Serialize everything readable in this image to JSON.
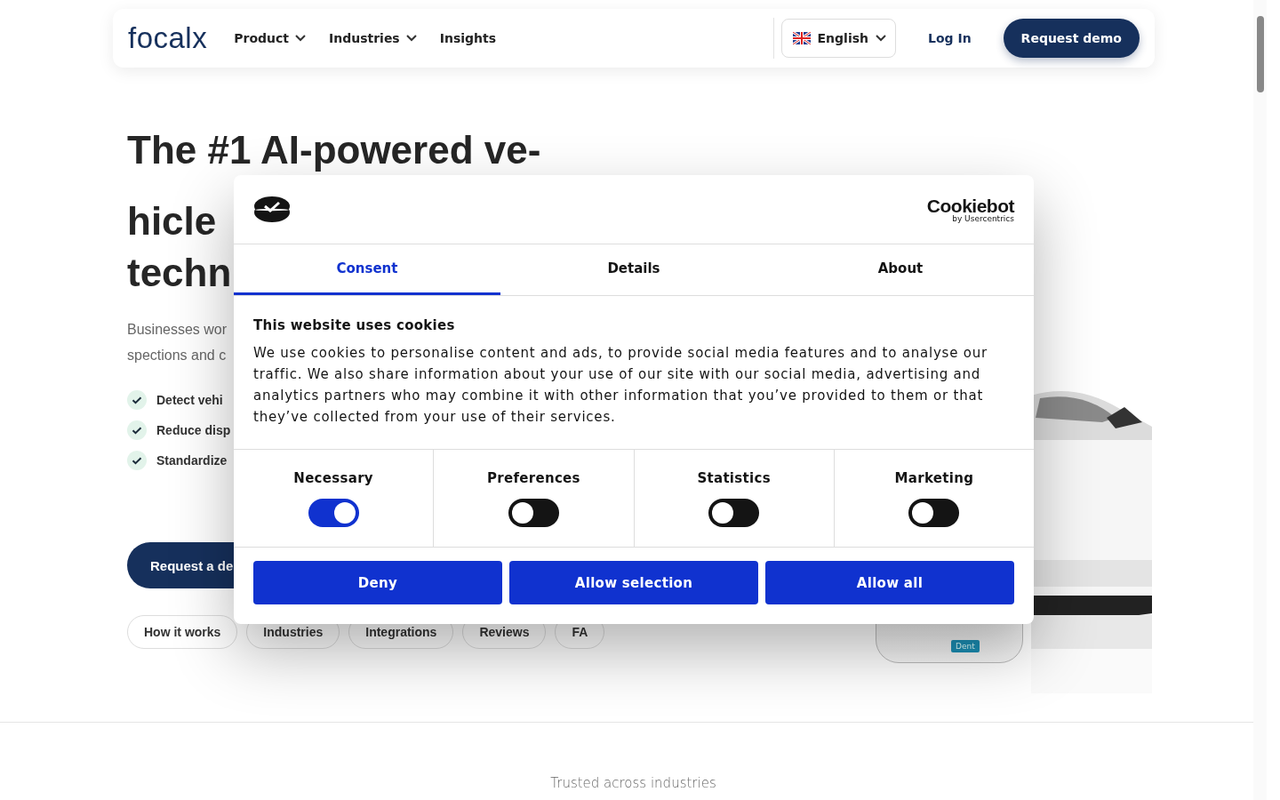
{
  "header": {
    "logo": "focalx",
    "nav": [
      {
        "label": "Product",
        "dropdown": true
      },
      {
        "label": "Industries",
        "dropdown": true
      },
      {
        "label": "Insights",
        "dropdown": false
      }
    ],
    "language": "English",
    "login": "Log In",
    "cta": "Request demo"
  },
  "hero": {
    "heading": [
      "The #1 AI-powered ve-",
      "hicle",
      "techn"
    ],
    "description": [
      "Businesses wor",
      "spections and c"
    ],
    "features": [
      "Detect vehi",
      "Reduce disp",
      "Standardize"
    ],
    "cta": "Request a de",
    "pills": [
      {
        "label": "How it works"
      },
      {
        "label": "Industries"
      },
      {
        "label": "Integrations"
      },
      {
        "label": "Reviews"
      },
      {
        "label": "FA"
      }
    ]
  },
  "showcase": {
    "kind": "picture",
    "tag": "Dent"
  },
  "trusted": "Trusted across industries",
  "cookie_dialog": {
    "brand": "Cookiebot",
    "brand_sub": "by Usercentrics",
    "tabs": [
      {
        "label": "Consent",
        "selected": true
      },
      {
        "label": "Details",
        "selected": false
      },
      {
        "label": "About",
        "selected": false
      }
    ],
    "title": "This website uses cookies",
    "body": "We use cookies to personalise content and ads, to provide social media features and to analyse our traffic. We also share information about your use of our site with our social media, advertising and analytics partners who may combine it with other information that you’ve provided to them or that they’ve collected from your use of their services.",
    "categories": [
      {
        "label": "Necessary",
        "checked": true
      },
      {
        "label": "Preferences",
        "checked": false
      },
      {
        "label": "Statistics",
        "checked": false
      },
      {
        "label": "Marketing",
        "checked": false
      }
    ],
    "buttons": [
      "Deny",
      "Allow selection",
      "Allow all"
    ]
  }
}
